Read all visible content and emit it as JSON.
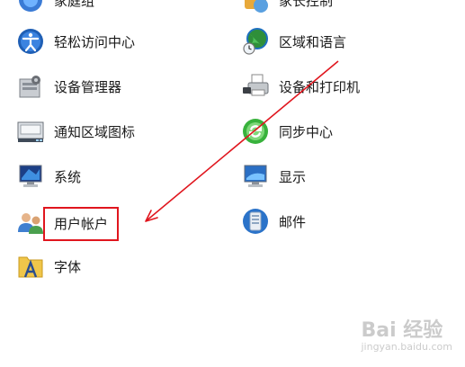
{
  "items": [
    {
      "label": "家庭组"
    },
    {
      "label": "家长控制"
    },
    {
      "label": "轻松访问中心"
    },
    {
      "label": "区域和语言"
    },
    {
      "label": "设备管理器"
    },
    {
      "label": "设备和打印机"
    },
    {
      "label": "通知区域图标"
    },
    {
      "label": "同步中心"
    },
    {
      "label": "系统"
    },
    {
      "label": "显示"
    },
    {
      "label": "用户帐户"
    },
    {
      "label": "邮件"
    },
    {
      "label": "字体"
    }
  ],
  "watermark": {
    "text": "Bai 经验",
    "sub": "jingyan.baidu.com"
  },
  "colors": {
    "highlight": "#e0161e",
    "arrow": "#e0161e"
  }
}
